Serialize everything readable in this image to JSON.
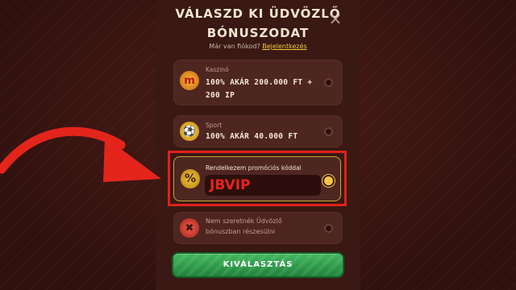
{
  "modal": {
    "title_line1": "VÁLASZD KI ÜDVÖZLŐ",
    "title_line2": "BÓNUSZODAT",
    "close_glyph": "×",
    "has_account": "Már van fiókod?",
    "login_link": "Bejelentkezés"
  },
  "options": [
    {
      "category": "Kaszinó",
      "line1": "100% AKÁR 200.000 FT +",
      "line2": "200 IP",
      "icon": "casino-icon",
      "selected": false
    },
    {
      "category": "Sport",
      "line1": "100% AKÁR 40.000 FT",
      "icon": "sport-ball-icon",
      "selected": false
    },
    {
      "category": "Rendelkezem promóciós kóddal",
      "promo_code": "JBVIP",
      "icon": "percent-icon",
      "selected": true
    },
    {
      "line1": "Nem szeretnék Üdvözlő",
      "line2": "bónuszban részesülni",
      "icon": "cross-icon",
      "selected": false
    }
  ],
  "cta_label": "KIVÁLASZTÁS",
  "colors": {
    "background": "#3b1512",
    "card": "#4e2620",
    "accent_gold": "#f2c744",
    "highlight_red": "#e0201a",
    "cta_green": "#2f9d4b"
  }
}
